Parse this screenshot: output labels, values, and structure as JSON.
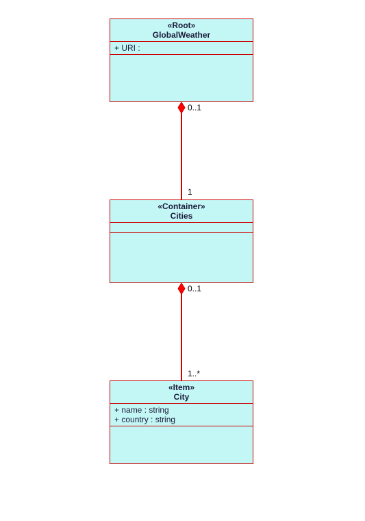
{
  "diagram": {
    "box1": {
      "stereotype": "«Root»",
      "name": "GlobalWeather",
      "attrs": [
        "+ URI :"
      ]
    },
    "box2": {
      "stereotype": "«Container»",
      "name": "Cities",
      "attrs": []
    },
    "box3": {
      "stereotype": "«Item»",
      "name": "City",
      "attrs": [
        "+ name : string",
        "+ country : string"
      ]
    },
    "mult": {
      "top_bottom": "0..1",
      "mid_top": "1",
      "mid_bottom": "0..1",
      "low_top": "1..*"
    }
  }
}
